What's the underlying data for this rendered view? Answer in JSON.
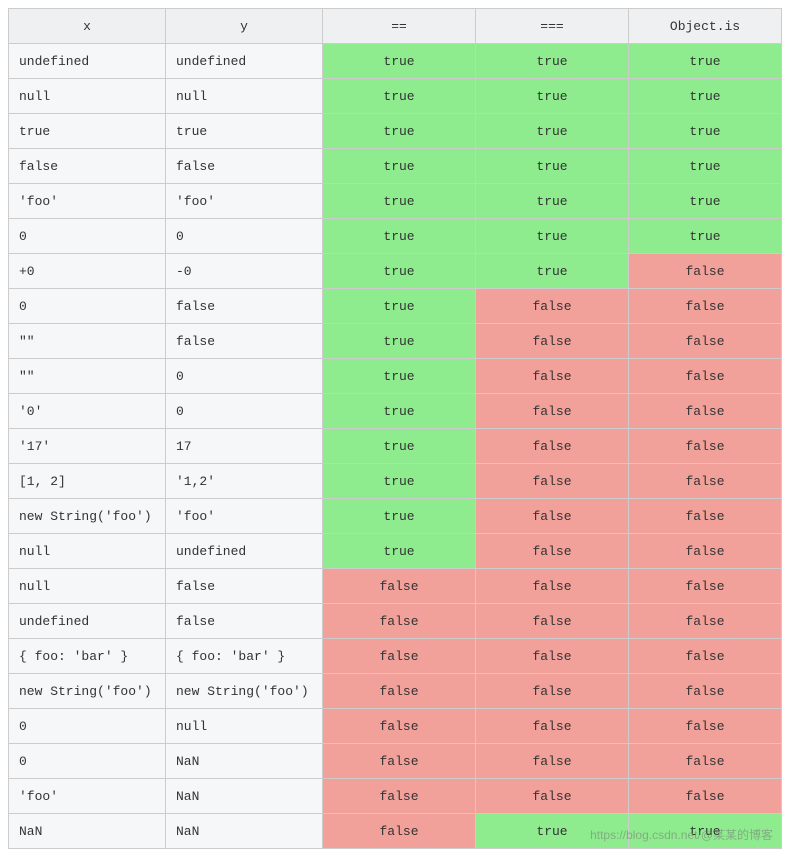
{
  "chart_data": {
    "type": "table",
    "title": "",
    "columns": [
      "x",
      "y",
      "==",
      "===",
      "Object.is"
    ],
    "rows": [
      {
        "x": "undefined",
        "y": "undefined",
        "eq": "true",
        "seq": "true",
        "ois": "true"
      },
      {
        "x": "null",
        "y": "null",
        "eq": "true",
        "seq": "true",
        "ois": "true"
      },
      {
        "x": "true",
        "y": "true",
        "eq": "true",
        "seq": "true",
        "ois": "true"
      },
      {
        "x": "false",
        "y": "false",
        "eq": "true",
        "seq": "true",
        "ois": "true"
      },
      {
        "x": "'foo'",
        "y": "'foo'",
        "eq": "true",
        "seq": "true",
        "ois": "true"
      },
      {
        "x": "0",
        "y": "0",
        "eq": "true",
        "seq": "true",
        "ois": "true"
      },
      {
        "x": "+0",
        "y": "-0",
        "eq": "true",
        "seq": "true",
        "ois": "false"
      },
      {
        "x": "0",
        "y": "false",
        "eq": "true",
        "seq": "false",
        "ois": "false"
      },
      {
        "x": "\"\"",
        "y": "false",
        "eq": "true",
        "seq": "false",
        "ois": "false"
      },
      {
        "x": "\"\"",
        "y": "0",
        "eq": "true",
        "seq": "false",
        "ois": "false"
      },
      {
        "x": "'0'",
        "y": "0",
        "eq": "true",
        "seq": "false",
        "ois": "false"
      },
      {
        "x": "'17'",
        "y": "17",
        "eq": "true",
        "seq": "false",
        "ois": "false"
      },
      {
        "x": "[1, 2]",
        "y": "'1,2'",
        "eq": "true",
        "seq": "false",
        "ois": "false"
      },
      {
        "x": "new String('foo')",
        "y": "'foo'",
        "eq": "true",
        "seq": "false",
        "ois": "false"
      },
      {
        "x": "null",
        "y": "undefined",
        "eq": "true",
        "seq": "false",
        "ois": "false"
      },
      {
        "x": "null",
        "y": "false",
        "eq": "false",
        "seq": "false",
        "ois": "false"
      },
      {
        "x": "undefined",
        "y": "false",
        "eq": "false",
        "seq": "false",
        "ois": "false"
      },
      {
        "x": "{ foo: 'bar' }",
        "y": "{ foo: 'bar' }",
        "eq": "false",
        "seq": "false",
        "ois": "false"
      },
      {
        "x": "new String('foo')",
        "y": "new String('foo')",
        "eq": "false",
        "seq": "false",
        "ois": "false"
      },
      {
        "x": "0",
        "y": "null",
        "eq": "false",
        "seq": "false",
        "ois": "false"
      },
      {
        "x": "0",
        "y": "NaN",
        "eq": "false",
        "seq": "false",
        "ois": "false"
      },
      {
        "x": "'foo'",
        "y": "NaN",
        "eq": "false",
        "seq": "false",
        "ois": "false"
      },
      {
        "x": "NaN",
        "y": "NaN",
        "eq": "false",
        "seq": "true",
        "ois": "true"
      }
    ]
  },
  "colors": {
    "true": "#8eec8e",
    "false": "#f2a09a"
  },
  "watermark": "https://blog.csdn.net/@某某的博客"
}
